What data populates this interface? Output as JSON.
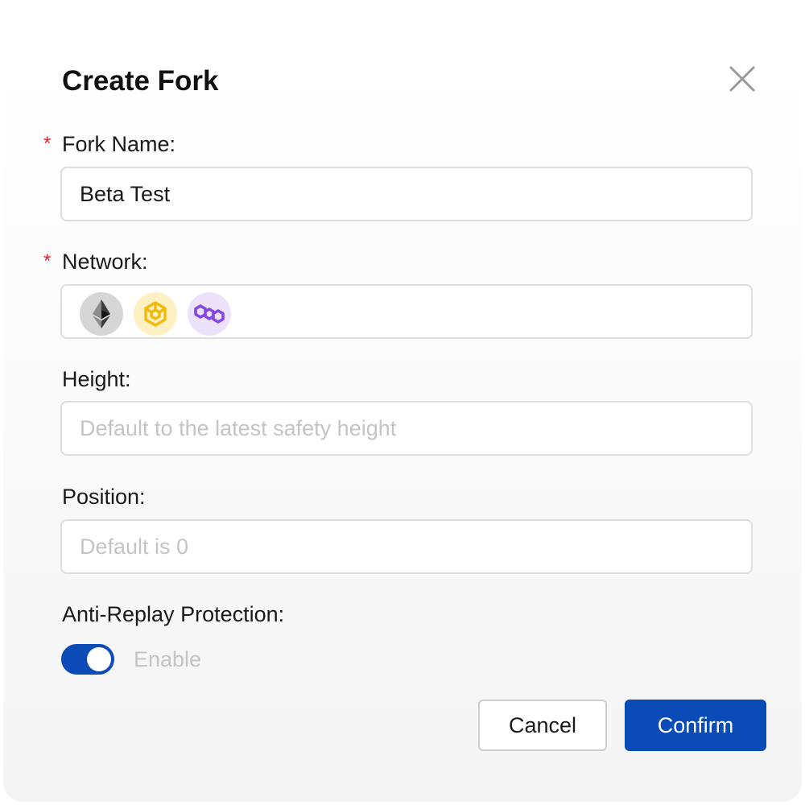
{
  "dialog": {
    "title": "Create Fork",
    "close_icon": "close-icon"
  },
  "fork_name": {
    "required_mark": "*",
    "label": "Fork Name:",
    "value": "Beta Test"
  },
  "network": {
    "required_mark": "*",
    "label": "Network:",
    "options": [
      {
        "icon": "ethereum-icon",
        "color": "#3c3c3d",
        "bg": "#d6d6d6"
      },
      {
        "icon": "bnb-chain-icon",
        "color": "#f0b90b",
        "bg": "#fdf0c2"
      },
      {
        "icon": "polygon-icon",
        "color": "#8247e5",
        "bg": "#ece3fb"
      }
    ]
  },
  "height": {
    "label": "Height:",
    "placeholder": "Default to the latest safety height",
    "value": ""
  },
  "position": {
    "label": "Position:",
    "placeholder": "Default is 0",
    "value": ""
  },
  "anti_replay": {
    "label": "Anti-Replay Protection:",
    "enabled": true,
    "toggle_text": "Enable"
  },
  "actions": {
    "cancel_label": "Cancel",
    "confirm_label": "Confirm"
  },
  "colors": {
    "accent": "#0a4bb8",
    "required": "#e5202a",
    "placeholder": "#c4c4c4",
    "border": "#dedede"
  }
}
